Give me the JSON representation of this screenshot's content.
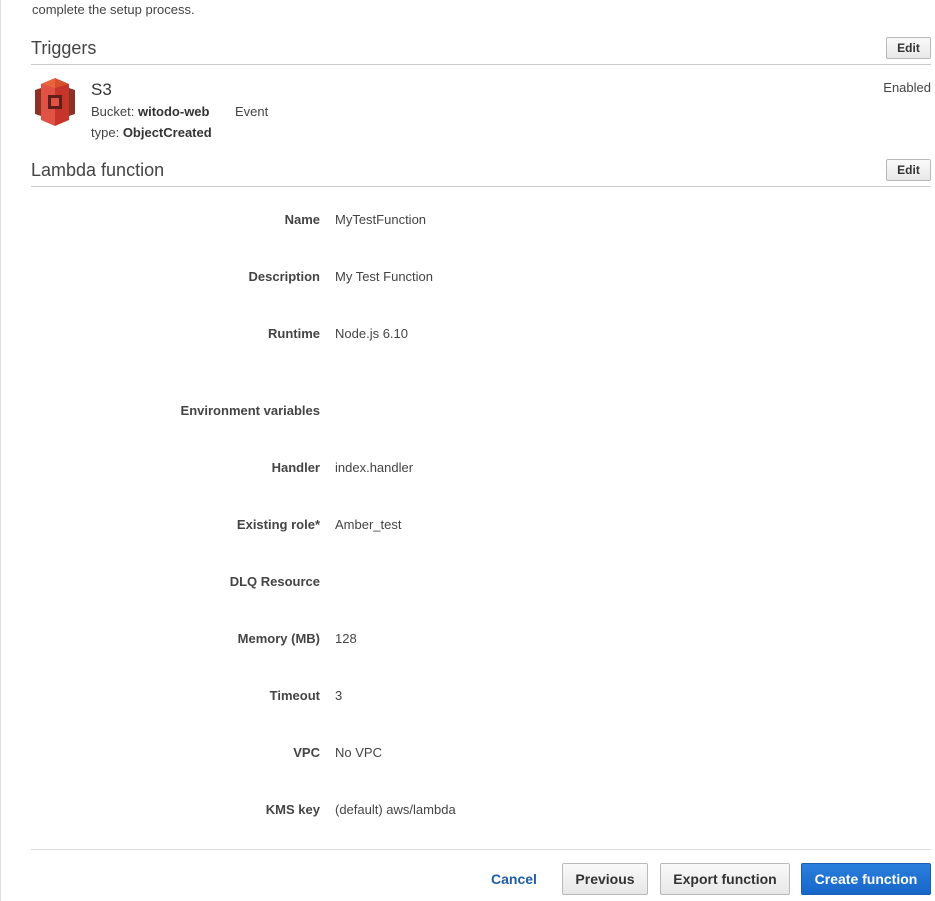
{
  "intro_text": "complete the setup process.",
  "triggers": {
    "title": "Triggers",
    "edit_label": "Edit",
    "item": {
      "icon": "s3-bucket-icon",
      "name": "S3",
      "bucket_label": "Bucket:",
      "bucket_value": "witodo-web",
      "event_label": "Event",
      "type_label": "type:",
      "type_value": "ObjectCreated",
      "status": "Enabled"
    }
  },
  "lambda": {
    "title": "Lambda function",
    "edit_label": "Edit",
    "fields": [
      {
        "label": "Name",
        "value": "MyTestFunction"
      },
      {
        "label": "Description",
        "value": "My Test Function"
      },
      {
        "label": "Runtime",
        "value": "Node.js 6.10"
      },
      {
        "label": "Environment variables",
        "value": ""
      },
      {
        "label": "Handler",
        "value": "index.handler"
      },
      {
        "label": "Existing role*",
        "value": "Amber_test"
      },
      {
        "label": "DLQ Resource",
        "value": ""
      },
      {
        "label": "Memory (MB)",
        "value": "128"
      },
      {
        "label": "Timeout",
        "value": "3"
      },
      {
        "label": "VPC",
        "value": "No VPC"
      },
      {
        "label": "KMS key",
        "value": "(default) aws/lambda"
      }
    ]
  },
  "footer": {
    "cancel_label": "Cancel",
    "previous_label": "Previous",
    "export_label": "Export function",
    "create_label": "Create function"
  },
  "colors": {
    "primary_button": "#1767c9",
    "link": "#1b5ea8",
    "s3_icon": "#c7352a"
  }
}
